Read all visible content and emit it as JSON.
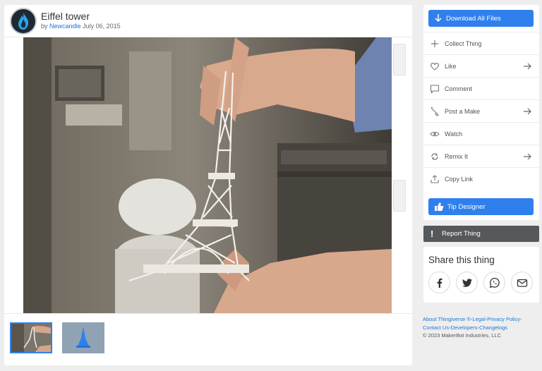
{
  "thing": {
    "title": "Eiffel tower",
    "by_prefix": "by",
    "author": "Newcandle",
    "date": "July 06, 2015"
  },
  "thumbnails": [
    {
      "icon": "photo-thumbnail",
      "selected": true
    },
    {
      "icon": "model-thumbnail",
      "selected": false
    }
  ],
  "sidebar": {
    "download_label": "Download All Files",
    "items": [
      {
        "label": "Collect Thing",
        "icon": "plus-icon",
        "arrow": false
      },
      {
        "label": "Like",
        "icon": "heart-icon",
        "arrow": true
      },
      {
        "label": "Comment",
        "icon": "comment-icon",
        "arrow": false
      },
      {
        "label": "Post a Make",
        "icon": "brush-icon",
        "arrow": true
      },
      {
        "label": "Watch",
        "icon": "eye-icon",
        "arrow": false
      },
      {
        "label": "Remix It",
        "icon": "remix-icon",
        "arrow": true
      },
      {
        "label": "Copy Link",
        "icon": "share-icon",
        "arrow": false
      }
    ],
    "tip_label": "Tip Designer"
  },
  "report": {
    "label": "Report Thing",
    "icon_glyph": "!"
  },
  "share": {
    "title": "Share this thing",
    "buttons": [
      "facebook-icon",
      "twitter-icon",
      "whatsapp-icon",
      "email-icon"
    ]
  },
  "footer": {
    "line1": "About Thingiverse ®-Legal-Privacy Policy-",
    "line2": "Contact Us-Developers-Changelogs",
    "line3": "©  2023  MakerBot Industries, LLC"
  },
  "colors": {
    "accent": "#2f80ed",
    "report_bg": "#55595c",
    "link": "#1e76d6"
  }
}
